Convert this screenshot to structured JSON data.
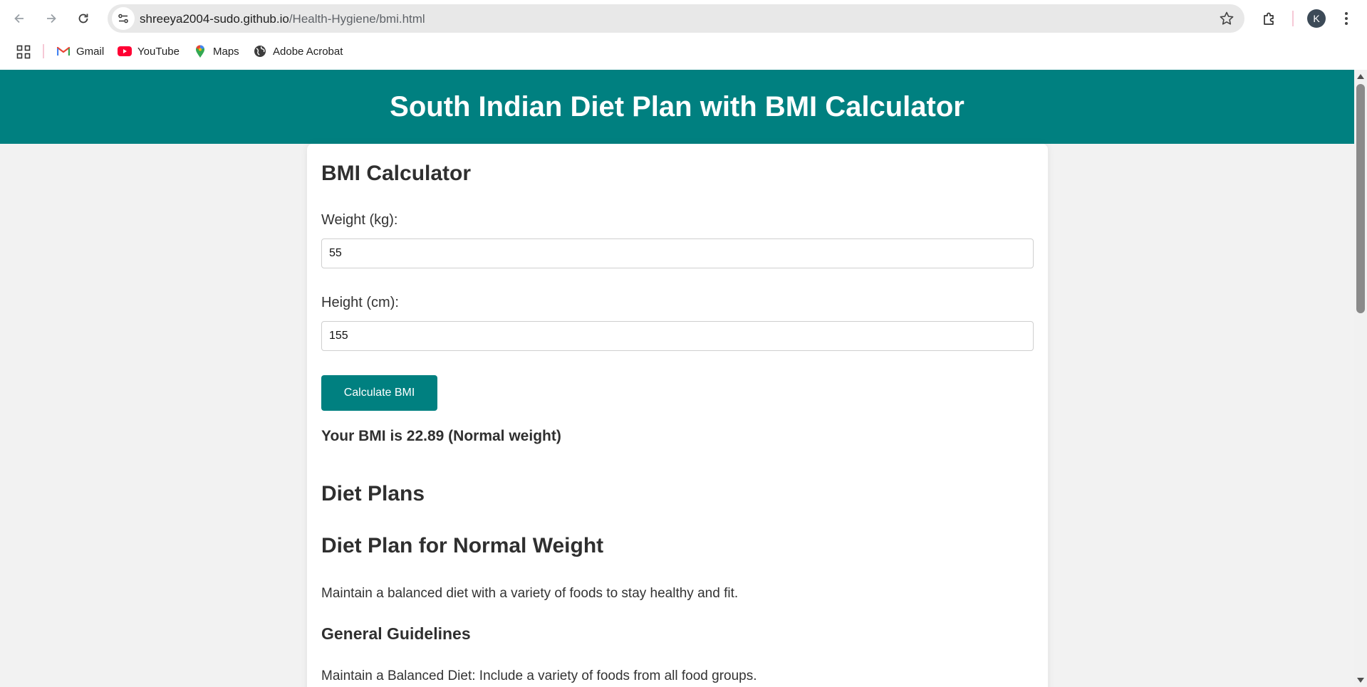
{
  "browser": {
    "url_host": "shreeya2004-sudo.github.io",
    "url_path": "/Health-Hygiene/bmi.html",
    "profile_initial": "K",
    "bookmarks": [
      {
        "label": "Gmail",
        "icon": "gmail-icon"
      },
      {
        "label": "YouTube",
        "icon": "youtube-icon"
      },
      {
        "label": "Maps",
        "icon": "maps-icon"
      },
      {
        "label": "Adobe Acrobat",
        "icon": "globe-icon"
      }
    ]
  },
  "page": {
    "title": "South Indian Diet Plan with BMI Calculator",
    "calculator": {
      "heading": "BMI Calculator",
      "weight_label": "Weight (kg):",
      "weight_value": "55",
      "height_label": "Height (cm):",
      "height_value": "155",
      "button_label": "Calculate BMI",
      "result": "Your BMI is 22.89 (Normal weight)"
    },
    "diet": {
      "heading": "Diet Plans",
      "plan_heading": "Diet Plan for Normal Weight",
      "plan_description": "Maintain a balanced diet with a variety of foods to stay healthy and fit.",
      "guidelines_heading": "General Guidelines",
      "guideline_1": "Maintain a Balanced Diet: Include a variety of foods from all food groups."
    }
  },
  "colors": {
    "header_bg": "#008080",
    "button_bg": "#008080",
    "page_bg": "#f2f2f2"
  }
}
